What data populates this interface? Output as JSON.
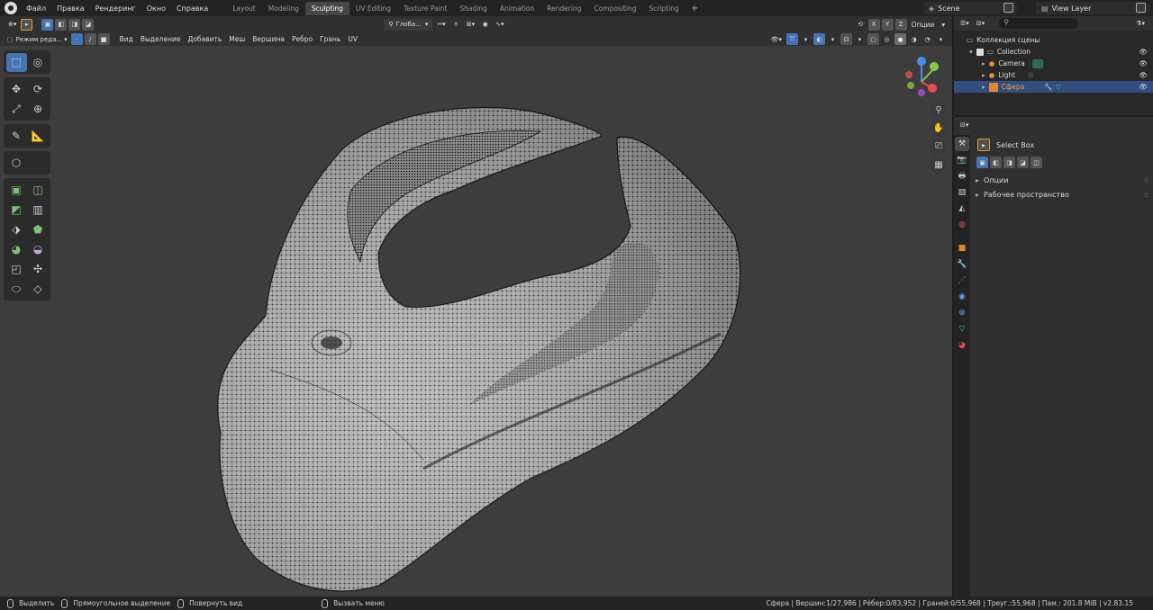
{
  "menus": [
    "Файл",
    "Правка",
    "Рендеринг",
    "Окно",
    "Справка"
  ],
  "workspaces": [
    "Layout",
    "Modeling",
    "Sculpting",
    "UV Editing",
    "Texture Paint",
    "Shading",
    "Animation",
    "Rendering",
    "Compositing",
    "Scripting"
  ],
  "active_workspace": "Sculpting",
  "scene": "Scene",
  "view_layer": "View Layer",
  "header1": {
    "orientation": "Глоба...",
    "options": "Опции",
    "axes": [
      "X",
      "Y",
      "Z"
    ]
  },
  "header2": {
    "mode": "Режим реда...",
    "items": [
      "Вид",
      "Выделение",
      "Добавить",
      "Меш",
      "Вершина",
      "Ребро",
      "Грань",
      "UV"
    ]
  },
  "outliner": {
    "root": "Коллекция сцены",
    "collection": "Collection",
    "items": [
      "Camera",
      "Light",
      "Сфера"
    ]
  },
  "properties": {
    "tool_name": "Select Box",
    "panels": [
      "Опции",
      "Рабочее пространство"
    ]
  },
  "status": {
    "left": [
      "Выделить",
      "Прямоугольное выделение",
      "Повернуть вид",
      "Вызвать меню"
    ],
    "right": "Сфера | Вершин:1/27,986 | Рёбер:0/83,952 | Граней:0/55,968 | Треуг.:55,968 | Пам.: 201.8 MiB | v2.83.15"
  },
  "colors": {
    "accent": "#4772b3",
    "viewport": "#3d3d3d",
    "axis_x": "#e54d4d",
    "axis_y": "#8bc34a",
    "axis_z": "#4b8eea"
  }
}
